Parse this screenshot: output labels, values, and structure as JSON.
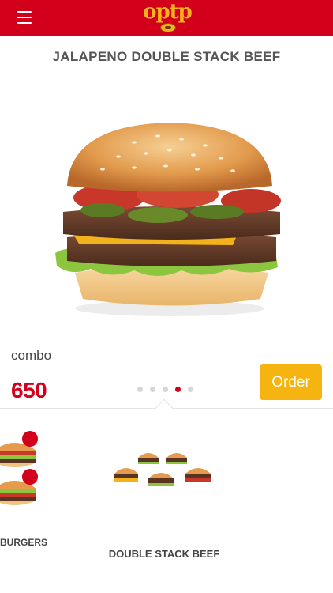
{
  "header": {
    "logo_text": "optp",
    "background": "#d3001c",
    "logo_color": "#f7b21b",
    "menu_icon": "hamburger-icon"
  },
  "product": {
    "title": "JALAPENO DOUBLE STACK BEEF",
    "combo_label": "combo",
    "price": "650",
    "order_label": "Order",
    "order_color": "#f5b40f",
    "price_color": "#d3001c"
  },
  "carousel": {
    "count": 5,
    "active_index": 3
  },
  "categories": {
    "items": [
      {
        "label": "BURGERS"
      },
      {
        "label": "DOUBLE STACK BEEF"
      }
    ]
  }
}
